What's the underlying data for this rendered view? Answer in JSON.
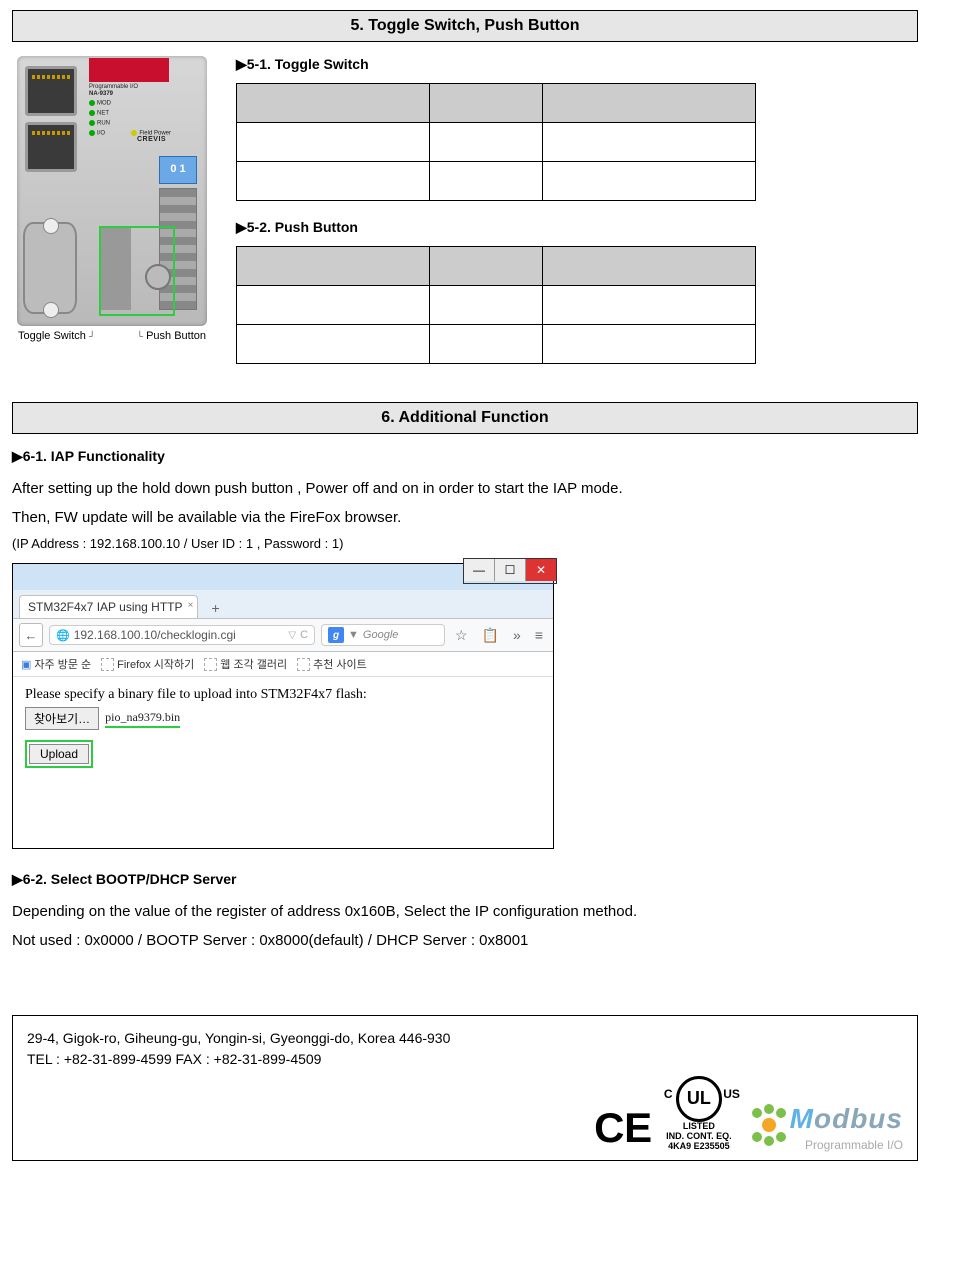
{
  "section5": {
    "title": "5. Toggle Switch, Push Button",
    "sub1": "▶5-1. Toggle Switch",
    "sub2": "▶5-2. Push Button",
    "fig_toggle_label": "Toggle Switch",
    "fig_push_label": "Push Button",
    "device": {
      "model_line1": "Programmable I/O",
      "model_line2": "NA-9379",
      "leds": [
        "MOD",
        "NET",
        "RUN",
        "I/O"
      ],
      "side_label": "Field Power",
      "brand": "CREVIS",
      "switch_label": "0 1"
    },
    "table51": {
      "headers": [
        "",
        "",
        ""
      ],
      "rows": [
        [
          "",
          "",
          ""
        ],
        [
          "",
          "",
          ""
        ]
      ]
    },
    "table52": {
      "headers": [
        "",
        "",
        ""
      ],
      "rows": [
        [
          "",
          "",
          ""
        ],
        [
          "",
          "",
          ""
        ]
      ]
    }
  },
  "section6": {
    "title": "6. Additional Function",
    "sub1": "▶6-1. IAP Functionality",
    "body1_line1": "After setting up the hold down push button , Power off and on in order to start the IAP mode.",
    "body1_line2": "Then, FW update will be available via the FireFox browser.",
    "body1_note": "(IP Address : 192.168.100.10  / User ID : 1 , Password : 1)",
    "sub2": "▶6-2. Select BOOTP/DHCP Server",
    "body2_line1": "Depending on the value of the register of address 0x160B, Select the IP configuration method.",
    "body2_line2": "Not used : 0x0000 / BOOTP Server : 0x8000(default) / DHCP Server : 0x8001"
  },
  "browser": {
    "tab_title": "STM32F4x7 IAP using HTTP",
    "url": "192.168.100.10/checklogin.cgi",
    "search_placeholder": "Google",
    "bookmarks": [
      "자주 방문 순",
      "Firefox 시작하기",
      "웹 조각 갤러리",
      "추천 사이트"
    ],
    "prompt": "Please specify a binary file to upload into STM32F4x7 flash:",
    "browse_btn": "찾아보기…",
    "filename": "pio_na9379.bin",
    "upload_btn": "Upload",
    "win_min": "—",
    "win_max": "☐",
    "win_close": "✕",
    "url_dropdown": "▽",
    "refresh": "C",
    "star": "☆",
    "clipboard": "📋",
    "more": "»",
    "menu": "≡",
    "search_dropdown": "▼"
  },
  "footer": {
    "address": "29-4, Gigok-ro, Giheung-gu, Yongin-si, Gyeonggi-do, Korea 446-930",
    "tel_fax": "TEL : +82-31-899-4599   FAX : +82-31-899-4509",
    "ce": "C E",
    "ul": {
      "mark": "UL",
      "c": "C",
      "us": "US",
      "listed": "LISTED",
      "line1": "IND. CONT. EQ.",
      "line2": "4KA9  E235505"
    },
    "modbus": {
      "name": "Modbus",
      "sub": "Programmable I/O"
    }
  }
}
